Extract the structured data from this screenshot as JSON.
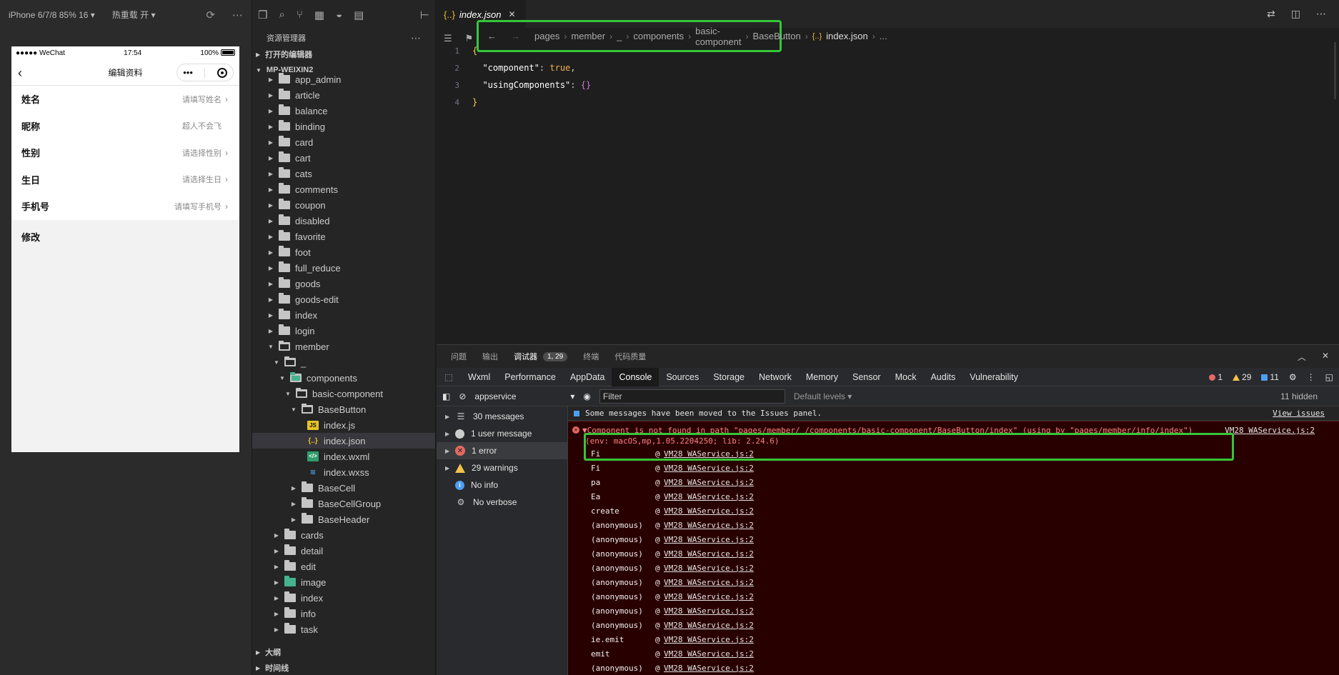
{
  "simulator": {
    "device": "iPhone 6/7/8 85% 16 ▾",
    "hot_reload": "热重载 开 ▾",
    "status": {
      "carrier": "●●●●● WeChat",
      "time": "17:54",
      "battery": "100%"
    },
    "nav_title": "编辑资料",
    "capsule_dots": "•••",
    "rows": [
      {
        "label": "姓名",
        "value": "请填写姓名",
        "arrow": true
      },
      {
        "label": "昵称",
        "value": "超人不会飞",
        "arrow": false
      },
      {
        "label": "性别",
        "value": "请选择性别",
        "arrow": true
      },
      {
        "label": "生日",
        "value": "请选择生日",
        "arrow": true
      },
      {
        "label": "手机号",
        "value": "请填写手机号",
        "arrow": true
      }
    ],
    "modify_label": "修改"
  },
  "explorer": {
    "title": "资源管理器",
    "open_editors": "打开的编辑器",
    "project": "MP-WEIXIN2",
    "tree": [
      {
        "name": "app_admin",
        "depth": 1,
        "type": "folder",
        "state": "closed"
      },
      {
        "name": "article",
        "depth": 1,
        "type": "folder",
        "state": "closed"
      },
      {
        "name": "balance",
        "depth": 1,
        "type": "folder",
        "state": "closed"
      },
      {
        "name": "binding",
        "depth": 1,
        "type": "folder",
        "state": "closed"
      },
      {
        "name": "card",
        "depth": 1,
        "type": "folder",
        "state": "closed"
      },
      {
        "name": "cart",
        "depth": 1,
        "type": "folder",
        "state": "closed"
      },
      {
        "name": "cats",
        "depth": 1,
        "type": "folder",
        "state": "closed"
      },
      {
        "name": "comments",
        "depth": 1,
        "type": "folder",
        "state": "closed"
      },
      {
        "name": "coupon",
        "depth": 1,
        "type": "folder",
        "state": "closed"
      },
      {
        "name": "disabled",
        "depth": 1,
        "type": "folder",
        "state": "closed"
      },
      {
        "name": "favorite",
        "depth": 1,
        "type": "folder",
        "state": "closed"
      },
      {
        "name": "foot",
        "depth": 1,
        "type": "folder",
        "state": "closed"
      },
      {
        "name": "full_reduce",
        "depth": 1,
        "type": "folder",
        "state": "closed"
      },
      {
        "name": "goods",
        "depth": 1,
        "type": "folder",
        "state": "closed"
      },
      {
        "name": "goods-edit",
        "depth": 1,
        "type": "folder",
        "state": "closed"
      },
      {
        "name": "index",
        "depth": 1,
        "type": "folder",
        "state": "closed"
      },
      {
        "name": "login",
        "depth": 1,
        "type": "folder",
        "state": "closed"
      },
      {
        "name": "member",
        "depth": 1,
        "type": "folder",
        "state": "open"
      },
      {
        "name": "_",
        "depth": 2,
        "type": "folder",
        "state": "open"
      },
      {
        "name": "components",
        "depth": 3,
        "type": "folder",
        "state": "open",
        "color": "green"
      },
      {
        "name": "basic-component",
        "depth": 4,
        "type": "folder",
        "state": "open"
      },
      {
        "name": "BaseButton",
        "depth": 5,
        "type": "folder",
        "state": "open"
      },
      {
        "name": "index.js",
        "depth": 6,
        "type": "js"
      },
      {
        "name": "index.json",
        "depth": 6,
        "type": "json",
        "active": true
      },
      {
        "name": "index.wxml",
        "depth": 6,
        "type": "wxml"
      },
      {
        "name": "index.wxss",
        "depth": 6,
        "type": "wxss"
      },
      {
        "name": "BaseCell",
        "depth": 5,
        "type": "folder",
        "state": "closed"
      },
      {
        "name": "BaseCellGroup",
        "depth": 5,
        "type": "folder",
        "state": "closed"
      },
      {
        "name": "BaseHeader",
        "depth": 5,
        "type": "folder",
        "state": "closed"
      },
      {
        "name": "cards",
        "depth": 2,
        "type": "folder",
        "state": "closed"
      },
      {
        "name": "detail",
        "depth": 2,
        "type": "folder",
        "state": "closed"
      },
      {
        "name": "edit",
        "depth": 2,
        "type": "folder",
        "state": "closed"
      },
      {
        "name": "image",
        "depth": 2,
        "type": "folder",
        "state": "closed",
        "color": "green"
      },
      {
        "name": "index",
        "depth": 2,
        "type": "folder",
        "state": "closed"
      },
      {
        "name": "info",
        "depth": 2,
        "type": "folder",
        "state": "closed"
      },
      {
        "name": "task",
        "depth": 2,
        "type": "folder",
        "state": "closed"
      }
    ],
    "outline": "大纲",
    "timeline": "时间线"
  },
  "editor": {
    "tab_name": "index.json",
    "breadcrumb": [
      "pages",
      "member",
      "_",
      "components",
      "basic-component",
      "BaseButton",
      "index.json",
      "..."
    ],
    "code": [
      {
        "n": "1",
        "parts": [
          {
            "t": "{",
            "c": "tk-brace"
          }
        ]
      },
      {
        "n": "2",
        "parts": [
          {
            "t": "  \"component\"",
            "c": "tk-key"
          },
          {
            "t": ": ",
            "c": ""
          },
          {
            "t": "true",
            "c": "tk-bool"
          },
          {
            "t": ",",
            "c": ""
          }
        ]
      },
      {
        "n": "3",
        "parts": [
          {
            "t": "  \"usingComponents\"",
            "c": "tk-key"
          },
          {
            "t": ": ",
            "c": ""
          },
          {
            "t": "{}",
            "c": "tk-obj"
          }
        ]
      },
      {
        "n": "4",
        "parts": [
          {
            "t": "}",
            "c": "tk-brace"
          }
        ]
      }
    ]
  },
  "panel": {
    "tabs": [
      "问题",
      "输出",
      "调试器",
      "终端",
      "代码质量"
    ],
    "active_tab": "调试器",
    "debugger_badge": "1, 29",
    "devtools_tabs": [
      "Wxml",
      "Performance",
      "AppData",
      "Console",
      "Sources",
      "Storage",
      "Network",
      "Memory",
      "Sensor",
      "Mock",
      "Audits",
      "Vulnerability"
    ],
    "active_devtools_tab": "Console",
    "counts": {
      "errors": "1",
      "warnings": "29",
      "info": "11"
    },
    "context": "appservice",
    "filter_placeholder": "Filter",
    "levels": "Default levels ▾",
    "hidden": "11 hidden",
    "sidebar": [
      {
        "label": "30 messages",
        "icon": "list"
      },
      {
        "label": "1 user message",
        "icon": "user"
      },
      {
        "label": "1 error",
        "icon": "err",
        "active": true
      },
      {
        "label": "29 warnings",
        "icon": "warn"
      },
      {
        "label": "No info",
        "icon": "info"
      },
      {
        "label": "No verbose",
        "icon": "gear"
      }
    ],
    "moved_message": "Some messages have been moved to the Issues panel.",
    "view_issues": "View issues",
    "error": {
      "line1": "▼Component is not found in path \"pages/member/_/components/basic-component/BaseButton/index\" (using by \"pages/member/info/index\")",
      "line2": "(env: macOS,mp,1.05.2204250; lib: 2.24.6)",
      "source": "VM28 WAService.js:2"
    },
    "stack": [
      {
        "fn": "Fi",
        "loc": "VM28 WAService.js:2"
      },
      {
        "fn": "Fi",
        "loc": "VM28 WAService.js:2"
      },
      {
        "fn": "pa",
        "loc": "VM28 WAService.js:2"
      },
      {
        "fn": "Ea",
        "loc": "VM28 WAService.js:2"
      },
      {
        "fn": "create",
        "loc": "VM28 WAService.js:2"
      },
      {
        "fn": "(anonymous)",
        "loc": "VM28 WAService.js:2"
      },
      {
        "fn": "(anonymous)",
        "loc": "VM28 WAService.js:2"
      },
      {
        "fn": "(anonymous)",
        "loc": "VM28 WAService.js:2"
      },
      {
        "fn": "(anonymous)",
        "loc": "VM28 WAService.js:2"
      },
      {
        "fn": "(anonymous)",
        "loc": "VM28 WAService.js:2"
      },
      {
        "fn": "(anonymous)",
        "loc": "VM28 WAService.js:2"
      },
      {
        "fn": "(anonymous)",
        "loc": "VM28 WAService.js:2"
      },
      {
        "fn": "(anonymous)",
        "loc": "VM28 WAService.js:2"
      },
      {
        "fn": "ie.emit",
        "loc": "VM28 WAService.js:2"
      },
      {
        "fn": "emit",
        "loc": "VM28 WAService.js:2"
      },
      {
        "fn": "(anonymous)",
        "loc": "VM28 WAService.js:2"
      }
    ]
  },
  "colors": {
    "highlight": "#36c639",
    "error_bg": "#290000",
    "error_text": "#ff8080"
  }
}
